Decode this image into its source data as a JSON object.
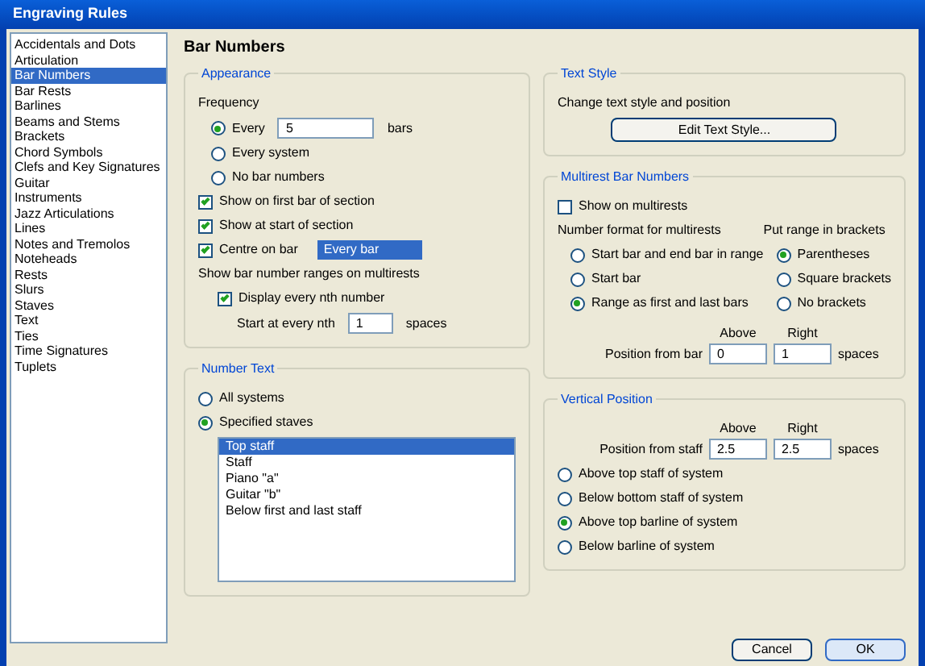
{
  "window": {
    "title": "Engraving Rules"
  },
  "sidebar": {
    "items": [
      {
        "label": "Accidentals and Dots",
        "selected": false
      },
      {
        "label": "Articulation",
        "selected": false
      },
      {
        "label": "Bar Numbers",
        "selected": true
      },
      {
        "label": "Bar Rests",
        "selected": false
      },
      {
        "label": "Barlines",
        "selected": false
      },
      {
        "label": "Beams and Stems",
        "selected": false
      },
      {
        "label": "Brackets",
        "selected": false
      },
      {
        "label": "Chord Symbols",
        "selected": false
      },
      {
        "label": "Clefs and Key Signatures",
        "selected": false
      },
      {
        "label": "Guitar",
        "selected": false
      },
      {
        "label": "Instruments",
        "selected": false
      },
      {
        "label": "Jazz Articulations",
        "selected": false
      },
      {
        "label": "Lines",
        "selected": false
      },
      {
        "label": "Notes and Tremolos",
        "selected": false
      },
      {
        "label": "Noteheads",
        "selected": false
      },
      {
        "label": "Rests",
        "selected": false
      },
      {
        "label": "Slurs",
        "selected": false
      },
      {
        "label": "Staves",
        "selected": false
      },
      {
        "label": "Text",
        "selected": false
      },
      {
        "label": "Ties",
        "selected": false
      },
      {
        "label": "Time Signatures",
        "selected": false
      },
      {
        "label": "Tuplets",
        "selected": false
      }
    ]
  },
  "page_title": "Bar Numbers",
  "appearance": {
    "title": "Appearance",
    "frequency_label": "Frequency",
    "frequency": [
      {
        "label": "Every",
        "selected": true
      },
      {
        "label": "Every system",
        "selected": false
      },
      {
        "label": "No bar numbers",
        "selected": false
      }
    ],
    "every_value": "5",
    "every_unit": "bars",
    "options": [
      {
        "label": "Show on first bar of section",
        "checked": true
      },
      {
        "label": "Show at start of section",
        "checked": true
      },
      {
        "label": "Centre on bar",
        "checked": true
      }
    ],
    "centre_value": "Every bar",
    "note": "Show bar number ranges on multirests",
    "sub_option": {
      "label": "Display every nth number",
      "checked": true
    },
    "nth_label": "Start at every nth",
    "nth_value": "1",
    "nth_unit": "spaces"
  },
  "systems": {
    "title": "Number Text",
    "choices": [
      {
        "label": "All systems",
        "selected": false
      },
      {
        "label": "Specified staves",
        "selected": true
      }
    ],
    "staves": [
      {
        "label": "Top staff",
        "selected": true
      },
      {
        "label": "Staff",
        "selected": false
      },
      {
        "label": "Piano \"a\"",
        "selected": false
      },
      {
        "label": "Guitar \"b\"",
        "selected": false
      },
      {
        "label": "Below first and last staff",
        "selected": false
      }
    ]
  },
  "text_style": {
    "title": "Text Style",
    "description": "Change text style and position",
    "button": "Edit Text Style..."
  },
  "multirest": {
    "title": "Multirest Bar Numbers",
    "show": {
      "label": "Show on multirests",
      "checked": false
    },
    "format_label": "Number format for multirests",
    "formats": [
      {
        "label": "Start bar and end bar in range",
        "selected": false
      },
      {
        "label": "Start bar",
        "selected": false
      },
      {
        "label": "Range as first and last bars",
        "selected": true
      }
    ],
    "brackets_label": "Put range in brackets",
    "brackets": [
      {
        "label": "Parentheses",
        "selected": true
      },
      {
        "label": "Square brackets",
        "selected": false
      },
      {
        "label": "No brackets",
        "selected": false
      }
    ],
    "above_label": "Above",
    "right_label": "Right",
    "position_label": "Position from bar",
    "above_value": "0",
    "right_value": "1",
    "unit": "spaces"
  },
  "vertical": {
    "title": "Vertical Position",
    "above_label": "Above",
    "right_label": "Right",
    "position_label": "Position from staff",
    "above_value": "2.5",
    "right_value": "2.5",
    "unit": "spaces",
    "choices": [
      {
        "label": "Above top staff of system",
        "selected": false
      },
      {
        "label": "Below bottom staff of system",
        "selected": false
      },
      {
        "label": "Above top barline of system",
        "selected": true
      },
      {
        "label": "Below barline of system",
        "selected": false
      }
    ]
  },
  "buttons": [
    {
      "label": "Cancel",
      "kind": "cancel"
    },
    {
      "label": "OK",
      "kind": "ok"
    }
  ]
}
